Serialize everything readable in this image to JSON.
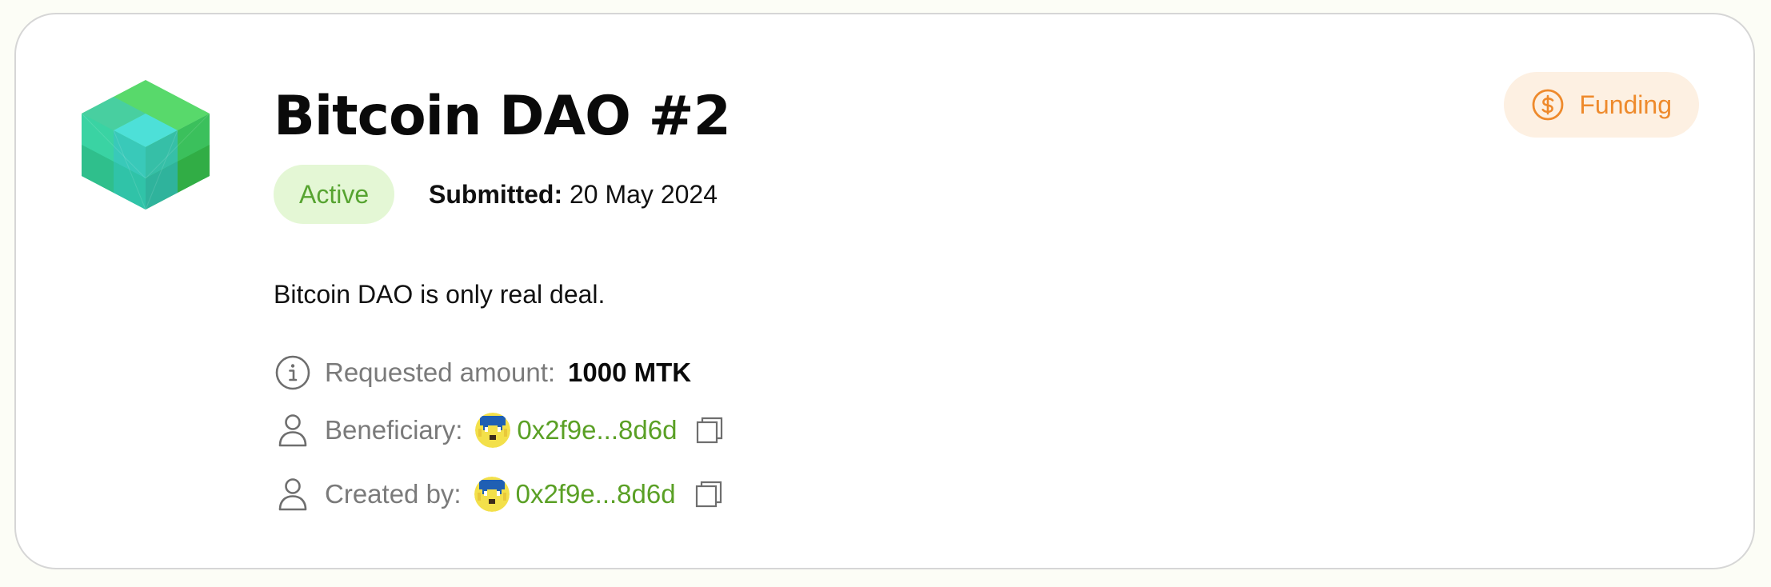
{
  "proposal": {
    "title": "Bitcoin DAO #2",
    "status": "Active",
    "submitted_label": "Submitted:",
    "submitted_date": "20 May 2024",
    "description": "Bitcoin DAO is only real deal.",
    "category": "Funding"
  },
  "details": {
    "requested_label": "Requested amount:",
    "requested_value": "1000 MTK",
    "beneficiary_label": "Beneficiary:",
    "beneficiary_address": "0x2f9e...8d6d",
    "created_label": "Created by:",
    "created_address": "0x2f9e...8d6d"
  },
  "colors": {
    "status_bg": "#e4f7d5",
    "status_text": "#57a431",
    "address": "#5aa025",
    "funding_bg": "#fdf0e2",
    "funding_text": "#ee8a2c"
  },
  "icons": {
    "logo": "dao-cube-logo",
    "funding": "dollar-circle-icon",
    "requested": "info-icon",
    "beneficiary": "user-icon",
    "created": "user-icon",
    "copy": "copy-icon"
  }
}
